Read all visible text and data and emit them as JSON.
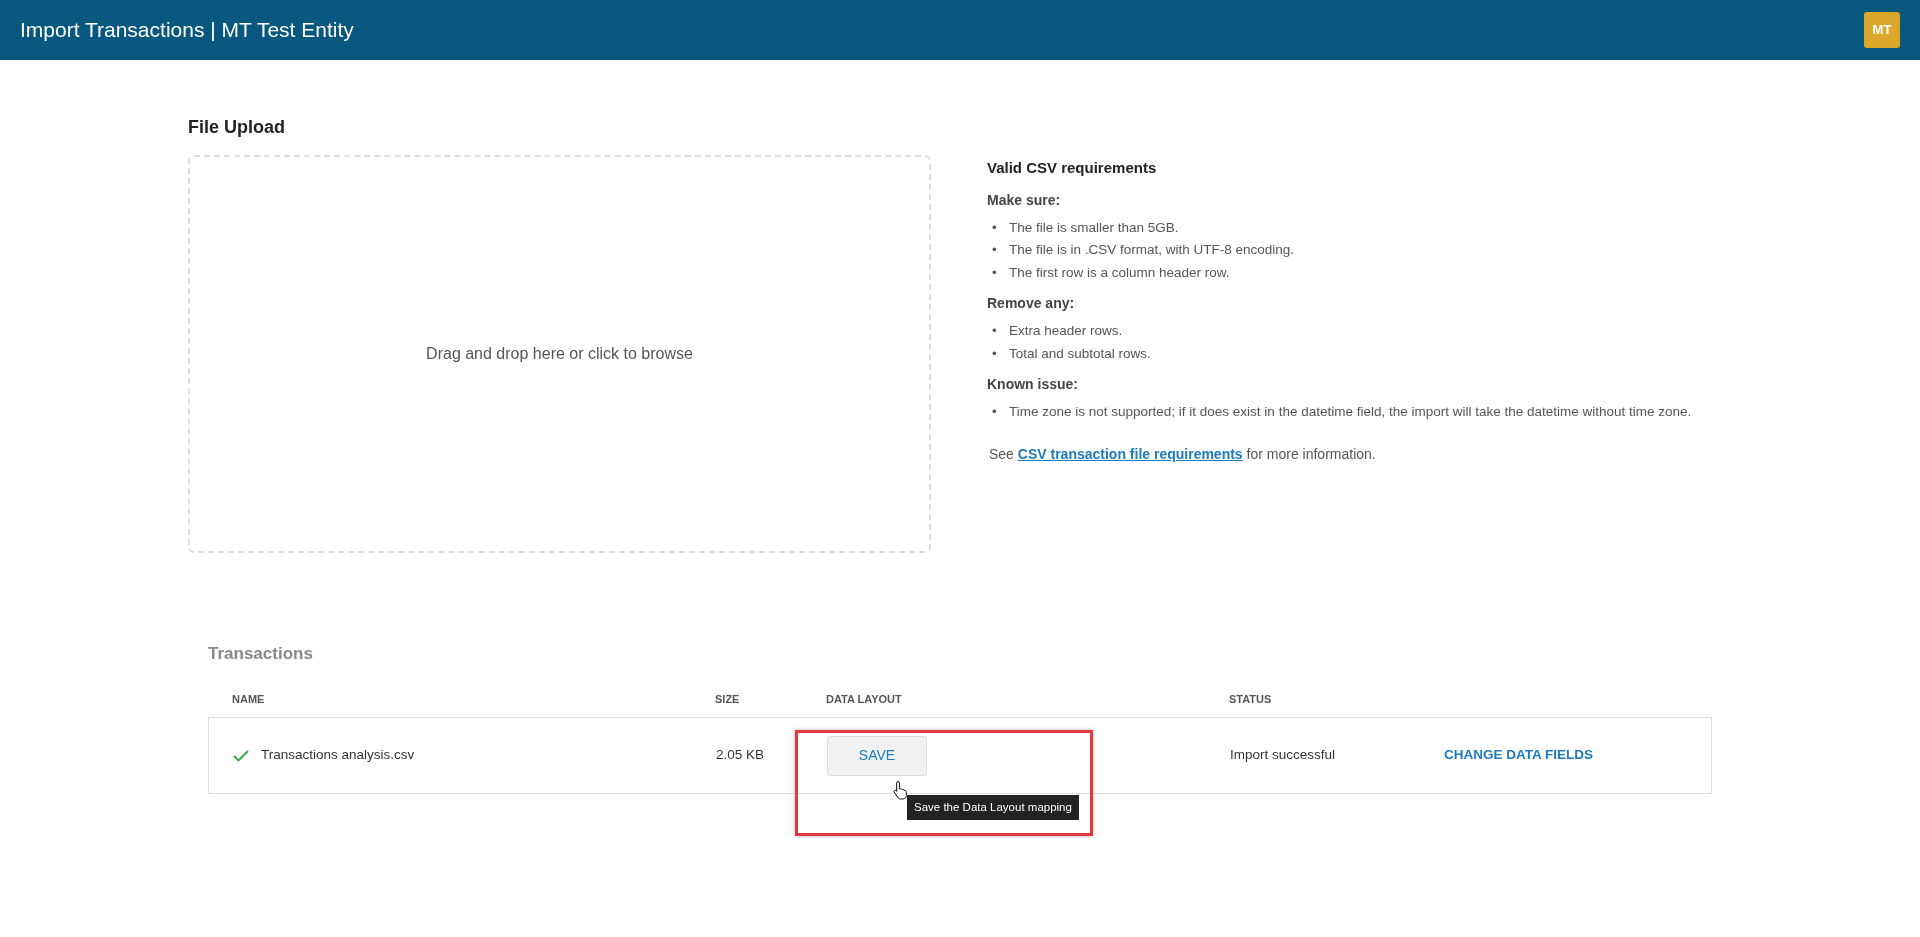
{
  "header": {
    "title": "Import Transactions | MT Test Entity",
    "avatar": "MT"
  },
  "upload": {
    "title": "File Upload",
    "dropzone": "Drag and drop here or click to browse"
  },
  "requirements": {
    "title": "Valid CSV requirements",
    "bullet": "•",
    "sections": [
      {
        "heading": "Make sure:",
        "items": [
          "The file is smaller than 5GB.",
          "The file is in .CSV format, with UTF-8 encoding.",
          "The first row is a column header row."
        ]
      },
      {
        "heading": "Remove any:",
        "items": [
          "Extra header rows.",
          "Total and subtotal rows."
        ]
      },
      {
        "heading": "Known issue:",
        "items": [
          "Time zone is not supported; if it does exist in the datetime field, the import will take the datetime without time zone."
        ]
      }
    ],
    "footer": {
      "before": "See",
      "link": "CSV transaction file requirements",
      "after": "for more information."
    }
  },
  "transactions": {
    "title": "Transactions",
    "columns": [
      "NAME",
      "SIZE",
      "DATA LAYOUT",
      "STATUS"
    ],
    "rows": [
      {
        "name": "Transactions analysis.csv",
        "size": "2.05 KB",
        "button": "SAVE",
        "status": "Import successful",
        "action": "CHANGE DATA FIELDS",
        "tooltip": "Save the Data Layout mapping"
      }
    ]
  }
}
